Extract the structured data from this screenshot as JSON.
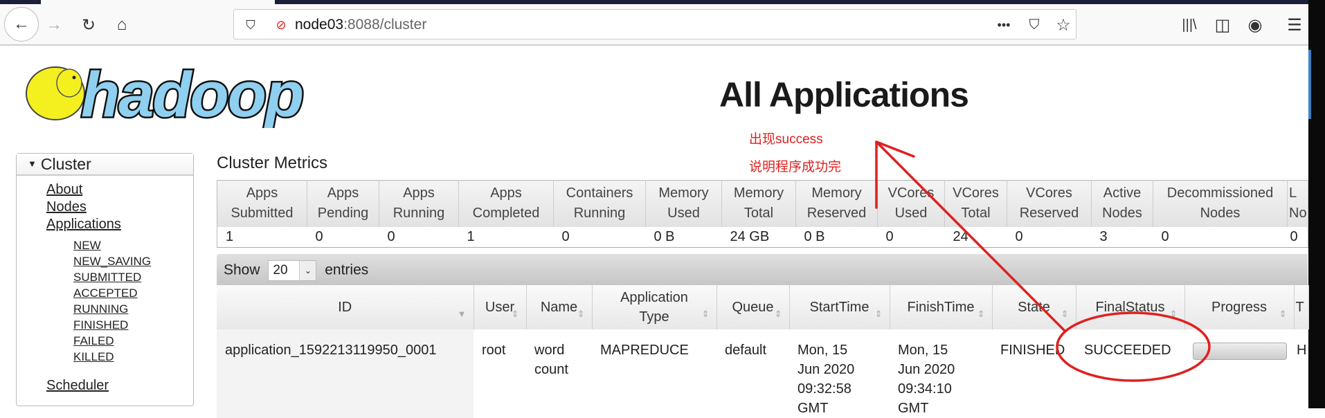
{
  "browser": {
    "url_host": "node03",
    "url_path": ":8088/cluster"
  },
  "logo_text": "hadoop",
  "page_title": "All Applications",
  "annotation": {
    "line1": "出现success",
    "line2": "说明程序成功完",
    "color": "#e0201f"
  },
  "sidebar": {
    "header": "Cluster",
    "links": {
      "about": "About",
      "nodes": "Nodes",
      "applications": "Applications",
      "scheduler": "Scheduler"
    },
    "states": [
      "NEW",
      "NEW_SAVING",
      "SUBMITTED",
      "ACCEPTED",
      "RUNNING",
      "FINISHED",
      "FAILED",
      "KILLED"
    ]
  },
  "metrics": {
    "heading": "Cluster Metrics",
    "headers": [
      [
        "Apps",
        "Submitted"
      ],
      [
        "Apps",
        "Pending"
      ],
      [
        "Apps",
        "Running"
      ],
      [
        "Apps",
        "Completed"
      ],
      [
        "Containers",
        "Running"
      ],
      [
        "Memory",
        "Used"
      ],
      [
        "Memory",
        "Total"
      ],
      [
        "Memory",
        "Reserved"
      ],
      [
        "VCores",
        "Used"
      ],
      [
        "VCores",
        "Total"
      ],
      [
        "VCores",
        "Reserved"
      ],
      [
        "Active",
        "Nodes"
      ],
      [
        "Decommissioned",
        "Nodes"
      ],
      [
        "L",
        "No"
      ]
    ],
    "values": [
      "1",
      "0",
      "0",
      "1",
      "0",
      "0 B",
      "24 GB",
      "0 B",
      "0",
      "24",
      "0",
      "3",
      "0",
      "0"
    ]
  },
  "show": {
    "label_pre": "Show",
    "value": "20",
    "label_post": "entries"
  },
  "apps_table": {
    "headers": [
      "ID",
      "User",
      "Name",
      "Application Type",
      "Queue",
      "StartTime",
      "FinishTime",
      "State",
      "FinalStatus",
      "Progress",
      "T"
    ],
    "rows": [
      {
        "id": "application_1592213119950_0001",
        "user": "root",
        "name": "word count",
        "type": "MAPREDUCE",
        "queue": "default",
        "start": "Mon, 15 Jun 2020 09:32:58 GMT",
        "finish": "Mon, 15 Jun 2020 09:34:10 GMT",
        "state": "FINISHED",
        "final_status": "SUCCEEDED",
        "progress": 0,
        "tracking": "H"
      }
    ]
  }
}
